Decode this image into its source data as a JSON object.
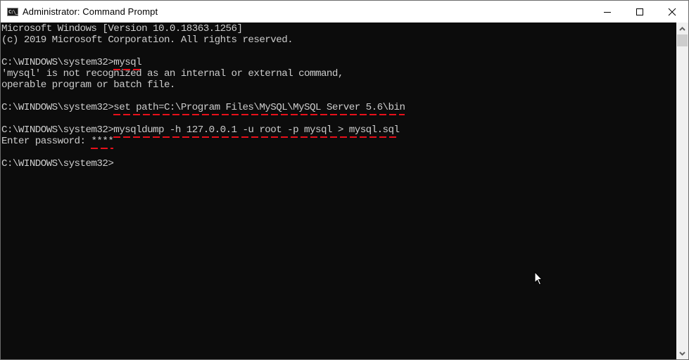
{
  "window": {
    "title": "Administrator: Command Prompt",
    "app_icon_text": "C:\\_",
    "controls": [
      "minimize",
      "maximize",
      "close"
    ]
  },
  "console": {
    "colors": {
      "background": "#0c0c0c",
      "foreground": "#cccccc",
      "annotation": "#e8101a"
    },
    "lines": [
      {
        "prompt": "",
        "text": "Microsoft Windows [Version 10.0.18363.1256]"
      },
      {
        "prompt": "",
        "text": "(c) 2019 Microsoft Corporation. All rights reserved."
      },
      {
        "prompt": "",
        "text": ""
      },
      {
        "prompt": "C:\\WINDOWS\\system32>",
        "text": "mysql",
        "underlined": true
      },
      {
        "prompt": "",
        "text": "'mysql' is not recognized as an internal or external command,"
      },
      {
        "prompt": "",
        "text": "operable program or batch file."
      },
      {
        "prompt": "",
        "text": ""
      },
      {
        "prompt": "C:\\WINDOWS\\system32>",
        "text": "set path=C:\\Program Files\\MySQL\\MySQL Server 5.6\\bin",
        "underlined": true
      },
      {
        "prompt": "",
        "text": ""
      },
      {
        "prompt": "C:\\WINDOWS\\system32>",
        "text": "mysqldump -h 127.0.0.1 -u root -p mysql > mysql.sql",
        "underlined": true
      },
      {
        "prompt": "Enter password: ",
        "text": "****",
        "underlined": true
      },
      {
        "prompt": "",
        "text": ""
      },
      {
        "prompt": "C:\\WINDOWS\\system32>",
        "text": ""
      }
    ]
  }
}
